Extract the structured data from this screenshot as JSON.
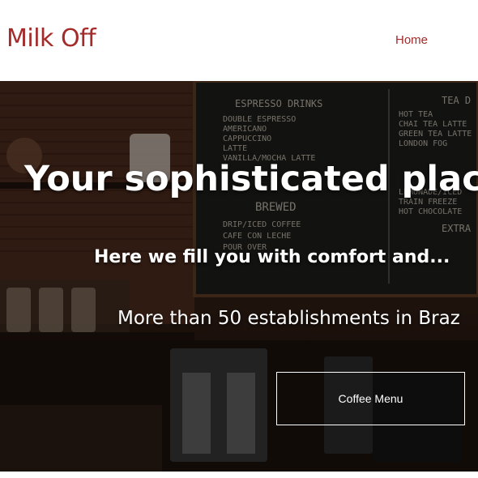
{
  "header": {
    "brand": "Milk Off",
    "nav": {
      "home_label": "Home"
    }
  },
  "hero": {
    "headline": "Your sophisticated place t",
    "subheadline": "Here we fill you with comfort and...",
    "tagline": "More than 50 establishments in Braz",
    "cta_label": "Coffee Menu"
  },
  "chalkboard": {
    "espresso_title": "ESPRESSO DRINKS",
    "espresso_items": [
      "DOUBLE ESPRESSO",
      "AMERICANO",
      "CAPPUCCINO",
      "LATTE",
      "VANILLA/MOCHA LATTE"
    ],
    "tea_title": "TEA D",
    "tea_items": [
      "HOT TEA",
      "CHAI TEA LATTE",
      "GREEN TEA LATTE",
      "LONDON FOG"
    ],
    "brewed_title": "BREWED",
    "brewed_items": [
      "DRIP/ICED COFFEE",
      "CAFE CON LECHE",
      "POUR OVER"
    ],
    "extra_items": [
      "LEMONADE/ICED",
      "TRAIN FREEZE",
      "HOT CHOCOLATE"
    ],
    "extra_title": "EXTRA"
  },
  "colors": {
    "brand": "#a52a2a",
    "hero_text": "#ffffff"
  }
}
